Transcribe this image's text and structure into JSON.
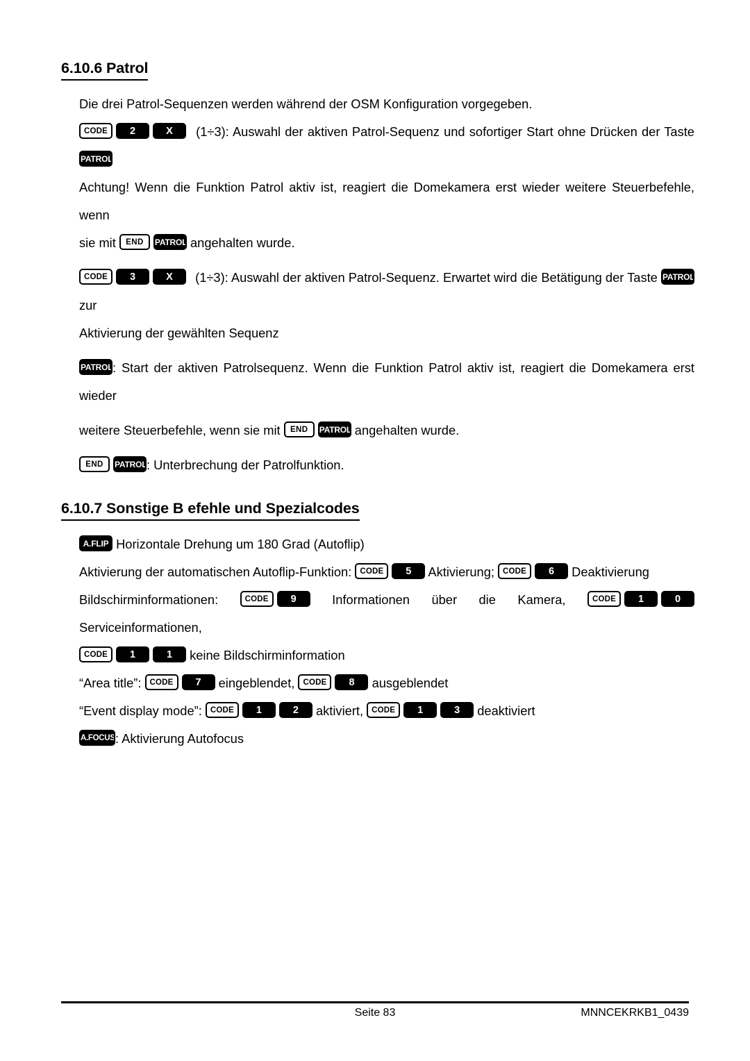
{
  "document": {
    "language": "de",
    "colors": {
      "text": "#000000",
      "background": "#ffffff",
      "key_dark_bg": "#000000",
      "key_dark_fg": "#ffffff",
      "key_light_bg": "#ffffff",
      "key_light_fg": "#000000"
    }
  },
  "sections": {
    "patrol": {
      "heading": "6.10.6 Patrol",
      "intro": "Die drei Patrol-Sequenzen werden während der OSM Konfiguration vorgegeben.",
      "p1": {
        "keys": [
          "CODE",
          "2",
          "X"
        ],
        "text_before": "(1÷3): Auswahl der aktiven Patrol-Sequenz und sofortiger Start ohne Drücken der Taste",
        "trailing_key": "PATROL"
      },
      "p2": {
        "text_a": "Achtung! Wenn die Funktion Patrol aktiv ist, reagiert die Domekamera erst wieder weitere Steuerbefehle, wenn",
        "text_b": "sie mit",
        "keys": [
          "END",
          "PATROL"
        ],
        "text_c": "angehalten wurde."
      },
      "p3": {
        "keys": [
          "CODE",
          "3",
          "X"
        ],
        "text_a": "(1÷3): Auswahl der aktiven Patrol-Sequenz. Erwartet wird die Betätigung der Taste",
        "mid_key": "PATROL",
        "text_b": "zur",
        "text_c": "Aktivierung der gewählten Sequenz"
      },
      "p4": {
        "lead_key": "PATROL",
        "text_a": ": Start der aktiven Patrolsequenz. Wenn die Funktion Patrol aktiv ist, reagiert die Domekamera erst wieder",
        "text_b": "weitere Steuerbefehle, wenn sie mit",
        "keys": [
          "END",
          "PATROL"
        ],
        "text_c": "angehalten wurde."
      },
      "p5": {
        "keys": [
          "END",
          "PATROL"
        ],
        "text": ": Unterbrechung der Patrolfunktion."
      }
    },
    "special_codes": {
      "heading": "6.10.7 Sonstige B efehle und Spezialcodes",
      "autoflip": {
        "key": "A.FLIP",
        "text": "Horizontale Drehung um 180 Grad (Autoflip)"
      },
      "autoflip_function": {
        "text_a": "Aktivierung der automatischen Autoflip-Funktion:",
        "keys_on": [
          "CODE",
          "5"
        ],
        "text_b": "Aktivierung;",
        "keys_off": [
          "CODE",
          "6"
        ],
        "text_c": "Deaktivierung"
      },
      "screen_info": {
        "text_a": "Bildschirminformationen:",
        "keys_camera": [
          "CODE",
          "9"
        ],
        "text_b": "Informationen über die Kamera,",
        "keys_service": [
          "CODE",
          "1",
          "0"
        ],
        "text_c": "Serviceinformationen,"
      },
      "no_screen_info": {
        "keys": [
          "CODE",
          "1",
          "1"
        ],
        "text": "keine Bildschirminformation"
      },
      "area_title": {
        "label": "“Area title”:",
        "keys_show": [
          "CODE",
          "7"
        ],
        "text_a": "eingeblendet,",
        "keys_hide": [
          "CODE",
          "8"
        ],
        "text_b": "ausgeblendet"
      },
      "event_display_mode": {
        "label": "“Event display mode”:",
        "keys_on": [
          "CODE",
          "1",
          "2"
        ],
        "text_a": "aktiviert,",
        "keys_off": [
          "CODE",
          "1",
          "3"
        ],
        "text_b": "deaktiviert"
      },
      "autofocus": {
        "key": "A.FOCUS",
        "text": ": Aktivierung Autofocus"
      }
    }
  },
  "footer": {
    "page_label": "Seite 83",
    "doc_id": "MNNCEKRKB1_0439"
  }
}
